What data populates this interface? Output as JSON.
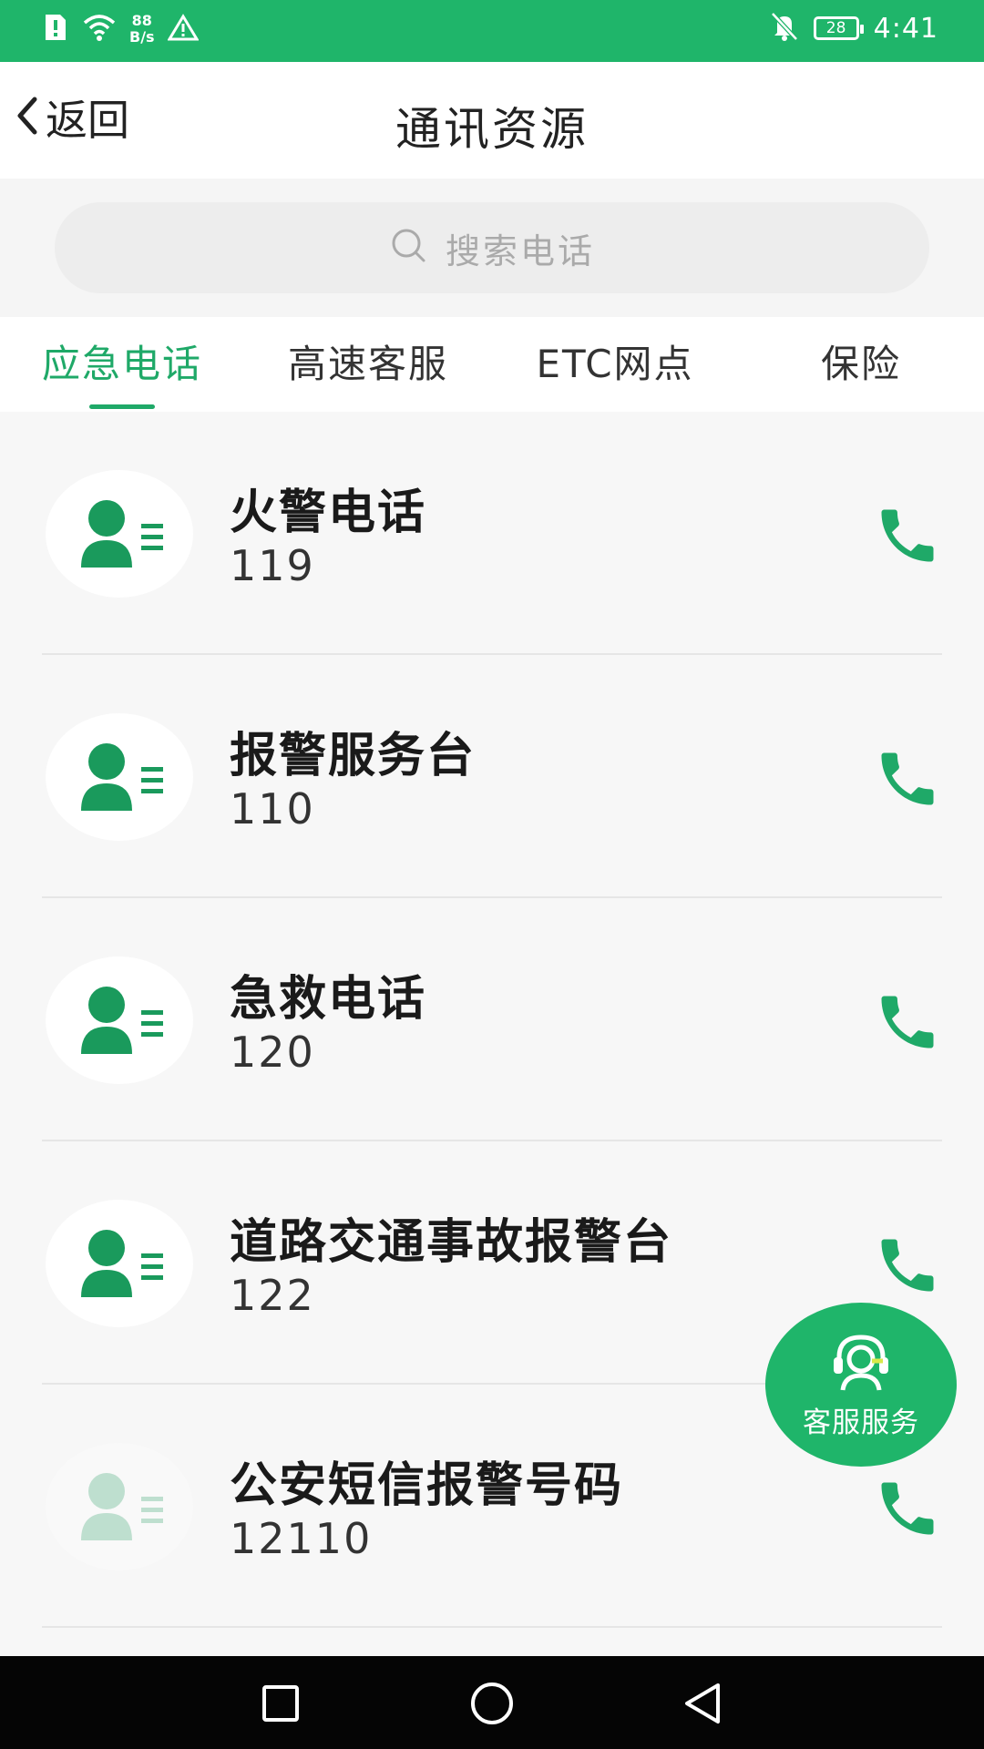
{
  "status_bar": {
    "net_speed_value": "88",
    "net_speed_unit": "B/s",
    "battery": "28",
    "time": "4:41"
  },
  "header": {
    "back_label": "返回",
    "title": "通讯资源"
  },
  "search": {
    "placeholder": "搜索电话"
  },
  "tabs": [
    {
      "label": "应急电话",
      "active": true
    },
    {
      "label": "高速客服",
      "active": false
    },
    {
      "label": "ETC网点",
      "active": false
    },
    {
      "label": "保险",
      "active": false
    }
  ],
  "contacts": [
    {
      "name": "火警电话",
      "number": "119"
    },
    {
      "name": "报警服务台",
      "number": "110"
    },
    {
      "name": "急救电话",
      "number": "120"
    },
    {
      "name": "道路交通事故报警台",
      "number": "122"
    },
    {
      "name": "公安短信报警号码",
      "number": "12110"
    }
  ],
  "fab": {
    "label": "客服服务",
    "icon": "headset-icon"
  },
  "colors": {
    "accent": "#1fb56a",
    "accent_dark": "#1fa968",
    "background": "#f7f7f7"
  },
  "icons": {
    "contact": "contact-person-icon",
    "call": "phone-icon",
    "back": "chevron-left-icon",
    "search": "search-icon"
  }
}
